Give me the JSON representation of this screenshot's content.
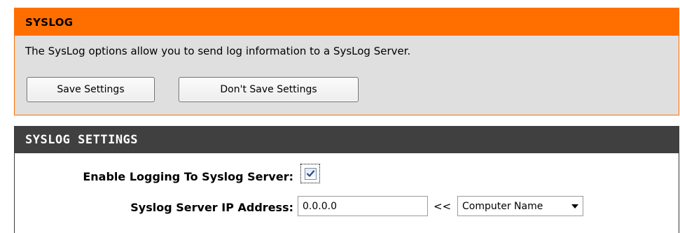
{
  "syslog": {
    "title": "SYSLOG",
    "description": "The SysLog options allow you to send log information to a SysLog Server.",
    "save_label": "Save Settings",
    "dont_save_label": "Don't Save Settings"
  },
  "settings": {
    "title": "SYSLOG SETTINGS",
    "enable_label": "Enable Logging To Syslog Server:",
    "enable_checked": true,
    "ip_label": "Syslog Server IP Address:",
    "ip_value": "0.0.0.0",
    "arrows": "<<",
    "computer_select_value": "Computer Name"
  },
  "colors": {
    "syslog_header": "#ff6f00",
    "syslog_body": "#dfdfdf",
    "settings_header": "#404040"
  },
  "icons": {
    "checkbox_mark": "checkmark-icon",
    "dropdown": "triangle-down-icon"
  }
}
